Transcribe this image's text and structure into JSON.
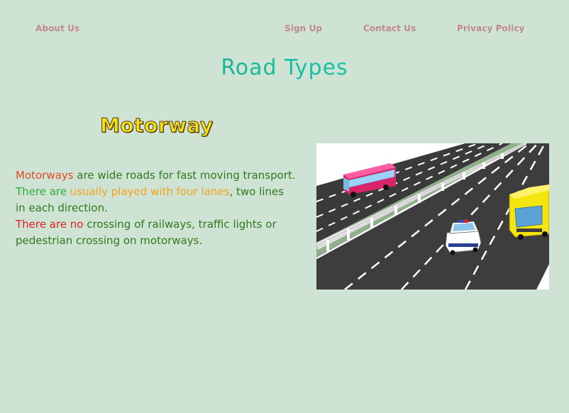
{
  "nav": {
    "about": "About Us",
    "signup": "Sign Up",
    "contact": "Contact Us",
    "privacy": "Privacy Policy"
  },
  "page": {
    "title": "Road Types"
  },
  "section": {
    "title": "Motorway",
    "paragraph": {
      "part1": "Motorways",
      "part2": " are wide roads for fast moving transport.",
      "part3": "There are ",
      "part4": "usually played with four lanes",
      "part5": ", two lines in each direction.",
      "part6": "There are no",
      "part7": " crossing of railways, traffic lights or pedestrian crossing on motorways."
    }
  },
  "colors": {
    "background": "#cfe3d5",
    "nav_link": "#c08a8a",
    "title_gradient_start": "#16a06c",
    "title_gradient_end": "#22e3d0",
    "section_title": "#f2e21a",
    "text_primary": "#2f7a1c",
    "text_red": "#e04a22",
    "text_green": "#2eaa3c",
    "text_orange": "#f3a21b",
    "text_crimson": "#e02020"
  },
  "image": {
    "content": "motorway-illustration",
    "vehicles": [
      "red-bus",
      "yellow-bus",
      "police-car"
    ]
  }
}
